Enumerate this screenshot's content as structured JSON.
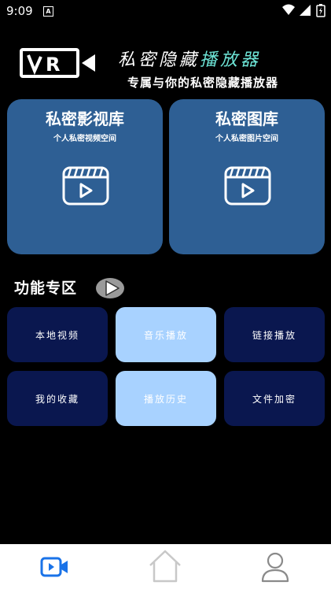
{
  "status_bar": {
    "time": "9:09",
    "notification_icon": "A"
  },
  "header": {
    "logo_letter": "R",
    "title_main": "私密隐藏",
    "title_accent": "播放器",
    "slogan": "专属与你的私密隐藏播放器"
  },
  "cards": [
    {
      "title": "私密影视库",
      "subtitle": "个人私密视频空间"
    },
    {
      "title": "私密图库",
      "subtitle": "个人私密图片空间"
    }
  ],
  "section_title": "功能专区",
  "tiles": [
    {
      "label": "本地视频"
    },
    {
      "label": "音乐播放"
    },
    {
      "label": "链接播放"
    },
    {
      "label": "我的收藏"
    },
    {
      "label": "播放历史"
    },
    {
      "label": "文件加密"
    }
  ],
  "colors": {
    "card_bg": "#2e5f94",
    "tile_dark": "#0a174f",
    "tile_light": "#a8d2ff",
    "nav_active": "#1a73e8"
  },
  "bottom_nav": [
    {
      "name": "video",
      "icon": "video-camera-icon",
      "active": true
    },
    {
      "name": "home",
      "icon": "home-icon",
      "active": false
    },
    {
      "name": "profile",
      "icon": "person-icon",
      "active": false
    }
  ]
}
